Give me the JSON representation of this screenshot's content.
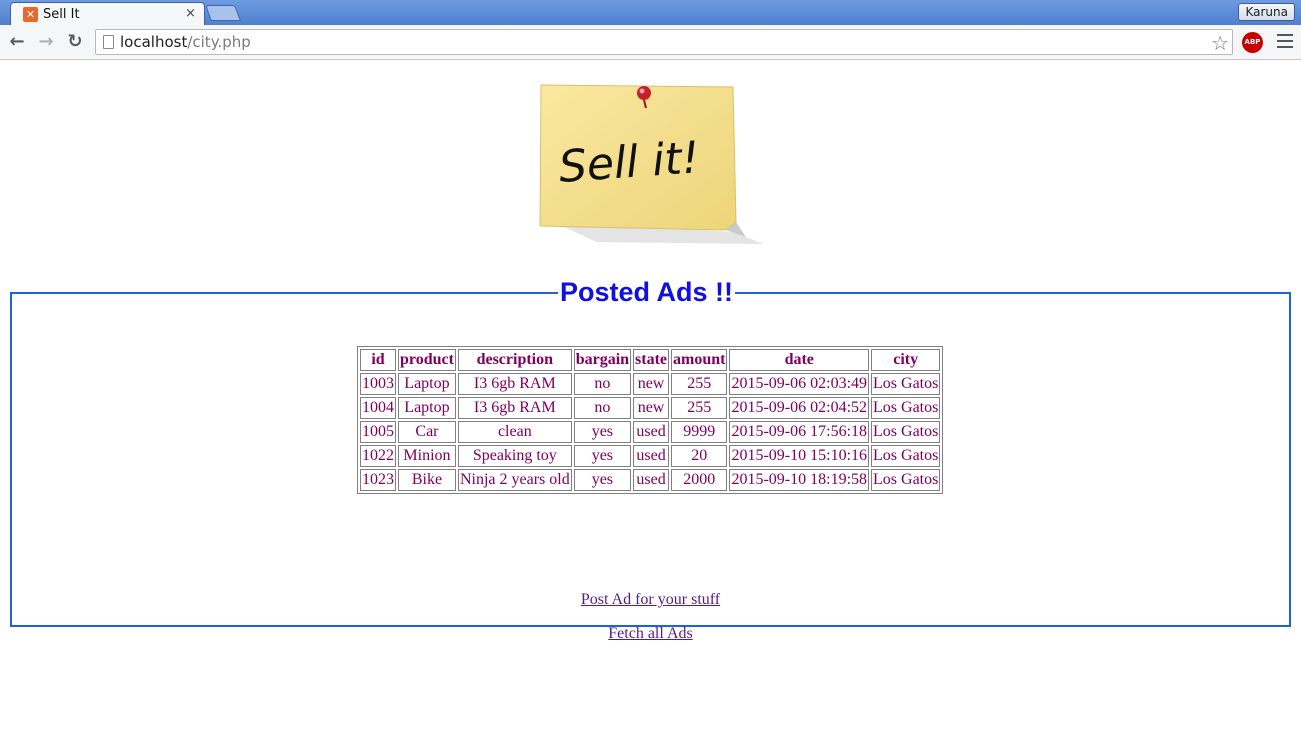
{
  "browser": {
    "tab_title": "Sell It",
    "tab_close": "×",
    "profile_name": "Karuna",
    "url_host": "localhost",
    "url_path": "/city.php",
    "back_icon": "←",
    "forward_icon": "→",
    "reload_icon": "↻",
    "star_icon": "☆",
    "adblock_label": "ABP"
  },
  "logo": {
    "text": "Sell it!"
  },
  "section": {
    "legend": "Posted Ads !!"
  },
  "table": {
    "headers": [
      "id",
      "product",
      "description",
      "bargain",
      "state",
      "amount",
      "date",
      "city"
    ],
    "rows": [
      [
        "1003",
        "Laptop",
        "I3 6gb RAM",
        "no",
        "new",
        "255",
        "2015-09-06 02:03:49",
        "Los Gatos"
      ],
      [
        "1004",
        "Laptop",
        "I3 6gb RAM",
        "no",
        "new",
        "255",
        "2015-09-06 02:04:52",
        "Los Gatos"
      ],
      [
        "1005",
        "Car",
        "clean",
        "yes",
        "used",
        "9999",
        "2015-09-06 17:56:18",
        "Los Gatos"
      ],
      [
        "1022",
        "Minion",
        "Speaking toy",
        "yes",
        "used",
        "20",
        "2015-09-10 15:10:16",
        "Los Gatos"
      ],
      [
        "1023",
        "Bike",
        "Ninja 2 years old",
        "yes",
        "used",
        "2000",
        "2015-09-10 18:19:58",
        "Los Gatos"
      ]
    ]
  },
  "links": {
    "post_ad": "Post Ad for your stuff",
    "fetch_all": "Fetch all Ads"
  },
  "colors": {
    "legend": "#1010e0",
    "table_text": "#800060",
    "fieldset_border": "#1f62d8",
    "link": "#551a8b"
  }
}
